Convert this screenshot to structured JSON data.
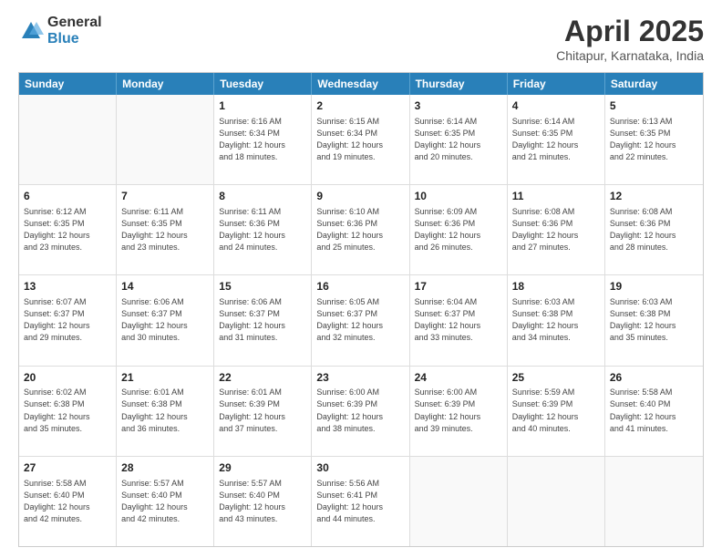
{
  "logo": {
    "general": "General",
    "blue": "Blue"
  },
  "header": {
    "title": "April 2025",
    "location": "Chitapur, Karnataka, India"
  },
  "days_of_week": [
    "Sunday",
    "Monday",
    "Tuesday",
    "Wednesday",
    "Thursday",
    "Friday",
    "Saturday"
  ],
  "weeks": [
    [
      {
        "day": "",
        "empty": true
      },
      {
        "day": "",
        "empty": true
      },
      {
        "day": "1",
        "sunrise": "6:16 AM",
        "sunset": "6:34 PM",
        "daylight": "12 hours and 18 minutes."
      },
      {
        "day": "2",
        "sunrise": "6:15 AM",
        "sunset": "6:34 PM",
        "daylight": "12 hours and 19 minutes."
      },
      {
        "day": "3",
        "sunrise": "6:14 AM",
        "sunset": "6:35 PM",
        "daylight": "12 hours and 20 minutes."
      },
      {
        "day": "4",
        "sunrise": "6:14 AM",
        "sunset": "6:35 PM",
        "daylight": "12 hours and 21 minutes."
      },
      {
        "day": "5",
        "sunrise": "6:13 AM",
        "sunset": "6:35 PM",
        "daylight": "12 hours and 22 minutes."
      }
    ],
    [
      {
        "day": "6",
        "sunrise": "6:12 AM",
        "sunset": "6:35 PM",
        "daylight": "12 hours and 23 minutes."
      },
      {
        "day": "7",
        "sunrise": "6:11 AM",
        "sunset": "6:35 PM",
        "daylight": "12 hours and 23 minutes."
      },
      {
        "day": "8",
        "sunrise": "6:11 AM",
        "sunset": "6:36 PM",
        "daylight": "12 hours and 24 minutes."
      },
      {
        "day": "9",
        "sunrise": "6:10 AM",
        "sunset": "6:36 PM",
        "daylight": "12 hours and 25 minutes."
      },
      {
        "day": "10",
        "sunrise": "6:09 AM",
        "sunset": "6:36 PM",
        "daylight": "12 hours and 26 minutes."
      },
      {
        "day": "11",
        "sunrise": "6:08 AM",
        "sunset": "6:36 PM",
        "daylight": "12 hours and 27 minutes."
      },
      {
        "day": "12",
        "sunrise": "6:08 AM",
        "sunset": "6:36 PM",
        "daylight": "12 hours and 28 minutes."
      }
    ],
    [
      {
        "day": "13",
        "sunrise": "6:07 AM",
        "sunset": "6:37 PM",
        "daylight": "12 hours and 29 minutes."
      },
      {
        "day": "14",
        "sunrise": "6:06 AM",
        "sunset": "6:37 PM",
        "daylight": "12 hours and 30 minutes."
      },
      {
        "day": "15",
        "sunrise": "6:06 AM",
        "sunset": "6:37 PM",
        "daylight": "12 hours and 31 minutes."
      },
      {
        "day": "16",
        "sunrise": "6:05 AM",
        "sunset": "6:37 PM",
        "daylight": "12 hours and 32 minutes."
      },
      {
        "day": "17",
        "sunrise": "6:04 AM",
        "sunset": "6:37 PM",
        "daylight": "12 hours and 33 minutes."
      },
      {
        "day": "18",
        "sunrise": "6:03 AM",
        "sunset": "6:38 PM",
        "daylight": "12 hours and 34 minutes."
      },
      {
        "day": "19",
        "sunrise": "6:03 AM",
        "sunset": "6:38 PM",
        "daylight": "12 hours and 35 minutes."
      }
    ],
    [
      {
        "day": "20",
        "sunrise": "6:02 AM",
        "sunset": "6:38 PM",
        "daylight": "12 hours and 35 minutes."
      },
      {
        "day": "21",
        "sunrise": "6:01 AM",
        "sunset": "6:38 PM",
        "daylight": "12 hours and 36 minutes."
      },
      {
        "day": "22",
        "sunrise": "6:01 AM",
        "sunset": "6:39 PM",
        "daylight": "12 hours and 37 minutes."
      },
      {
        "day": "23",
        "sunrise": "6:00 AM",
        "sunset": "6:39 PM",
        "daylight": "12 hours and 38 minutes."
      },
      {
        "day": "24",
        "sunrise": "6:00 AM",
        "sunset": "6:39 PM",
        "daylight": "12 hours and 39 minutes."
      },
      {
        "day": "25",
        "sunrise": "5:59 AM",
        "sunset": "6:39 PM",
        "daylight": "12 hours and 40 minutes."
      },
      {
        "day": "26",
        "sunrise": "5:58 AM",
        "sunset": "6:40 PM",
        "daylight": "12 hours and 41 minutes."
      }
    ],
    [
      {
        "day": "27",
        "sunrise": "5:58 AM",
        "sunset": "6:40 PM",
        "daylight": "12 hours and 42 minutes."
      },
      {
        "day": "28",
        "sunrise": "5:57 AM",
        "sunset": "6:40 PM",
        "daylight": "12 hours and 42 minutes."
      },
      {
        "day": "29",
        "sunrise": "5:57 AM",
        "sunset": "6:40 PM",
        "daylight": "12 hours and 43 minutes."
      },
      {
        "day": "30",
        "sunrise": "5:56 AM",
        "sunset": "6:41 PM",
        "daylight": "12 hours and 44 minutes."
      },
      {
        "day": "",
        "empty": true
      },
      {
        "day": "",
        "empty": true
      },
      {
        "day": "",
        "empty": true
      }
    ]
  ],
  "labels": {
    "sunrise": "Sunrise:",
    "sunset": "Sunset:",
    "daylight": "Daylight: 12 hours"
  }
}
